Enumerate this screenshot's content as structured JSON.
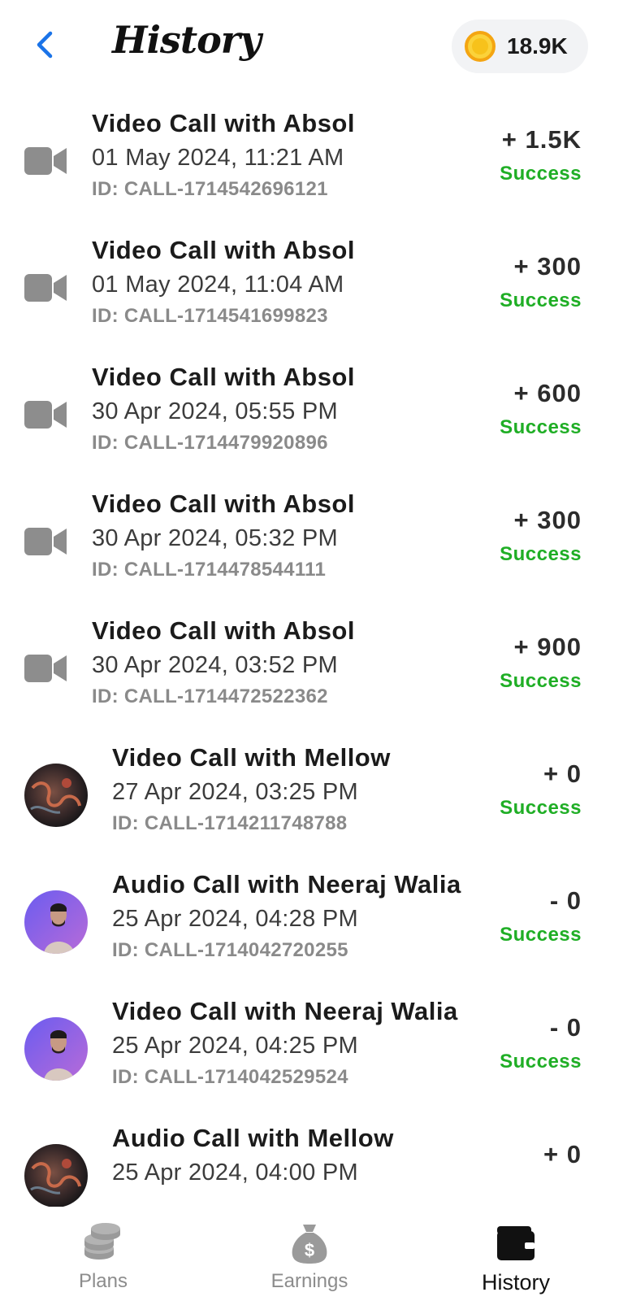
{
  "header": {
    "title": "History",
    "coin_balance": "18.9K"
  },
  "transactions": [
    {
      "icon": "video-camera-icon",
      "title": "Video Call with Absol",
      "date": "01 May 2024, 11:21 AM",
      "call_id": "ID: CALL-1714542696121",
      "amount": "+ 1.5K",
      "status": "Success"
    },
    {
      "icon": "video-camera-icon",
      "title": "Video Call with Absol",
      "date": "01 May 2024, 11:04 AM",
      "call_id": "ID: CALL-1714541699823",
      "amount": "+ 300",
      "status": "Success"
    },
    {
      "icon": "video-camera-icon",
      "title": "Video Call with Absol",
      "date": "30 Apr 2024, 05:55 PM",
      "call_id": "ID: CALL-1714479920896",
      "amount": "+ 600",
      "status": "Success"
    },
    {
      "icon": "video-camera-icon",
      "title": "Video Call with Absol",
      "date": "30 Apr 2024, 05:32 PM",
      "call_id": "ID: CALL-1714478544111",
      "amount": "+ 300",
      "status": "Success"
    },
    {
      "icon": "video-camera-icon",
      "title": "Video Call with Absol",
      "date": "30 Apr 2024, 03:52 PM",
      "call_id": "ID: CALL-1714472522362",
      "amount": "+ 900",
      "status": "Success"
    },
    {
      "icon": "avatar-mellow",
      "title": "Video Call with Mellow",
      "date": "27 Apr 2024, 03:25 PM",
      "call_id": "ID: CALL-1714211748788",
      "amount": "+ 0",
      "status": "Success"
    },
    {
      "icon": "avatar-neeraj",
      "title": "Audio Call with Neeraj Walia",
      "date": "25 Apr 2024, 04:28 PM",
      "call_id": "ID: CALL-1714042720255",
      "amount": "- 0",
      "status": "Success"
    },
    {
      "icon": "avatar-neeraj",
      "title": "Video Call with Neeraj Walia",
      "date": "25 Apr 2024, 04:25 PM",
      "call_id": "ID: CALL-1714042529524",
      "amount": "- 0",
      "status": "Success"
    },
    {
      "icon": "avatar-mellow",
      "title": "Audio Call with Mellow",
      "date": "25 Apr 2024, 04:00 PM",
      "call_id": "",
      "amount": "+ 0",
      "status": ""
    }
  ],
  "bottom_nav": [
    {
      "label": "Plans",
      "icon": "coins-stack-icon",
      "active": false
    },
    {
      "label": "Earnings",
      "icon": "money-bag-icon",
      "active": false
    },
    {
      "label": "History",
      "icon": "wallet-icon",
      "active": true
    }
  ],
  "colors": {
    "success": "#1fae25",
    "back_arrow": "#1a73e8",
    "coin": "#f7c21b"
  }
}
